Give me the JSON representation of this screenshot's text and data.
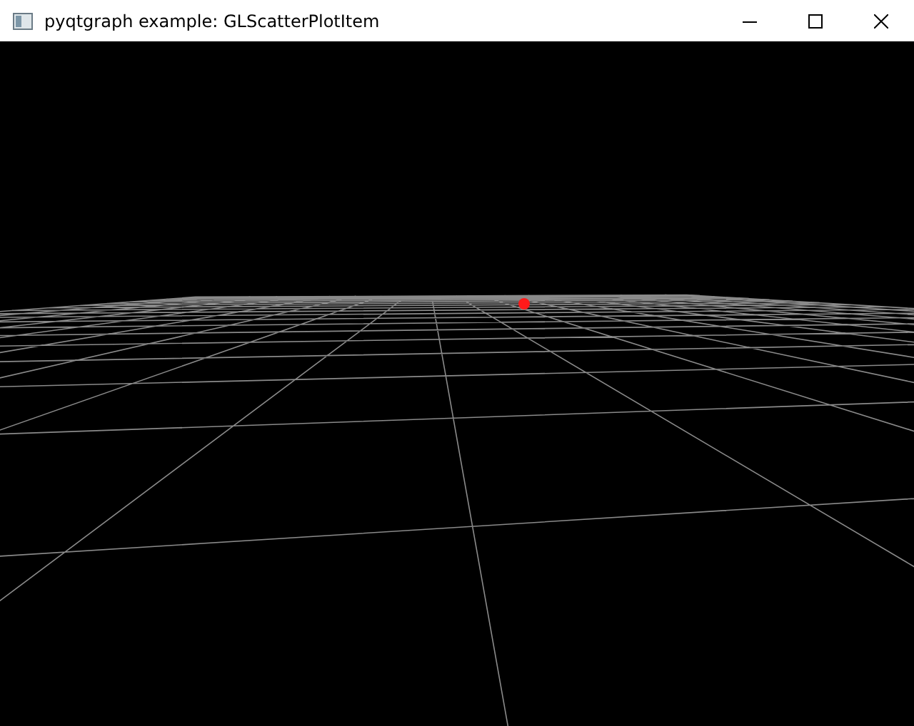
{
  "window": {
    "title": "pyqtgraph example: GLScatterPlotItem"
  }
}
